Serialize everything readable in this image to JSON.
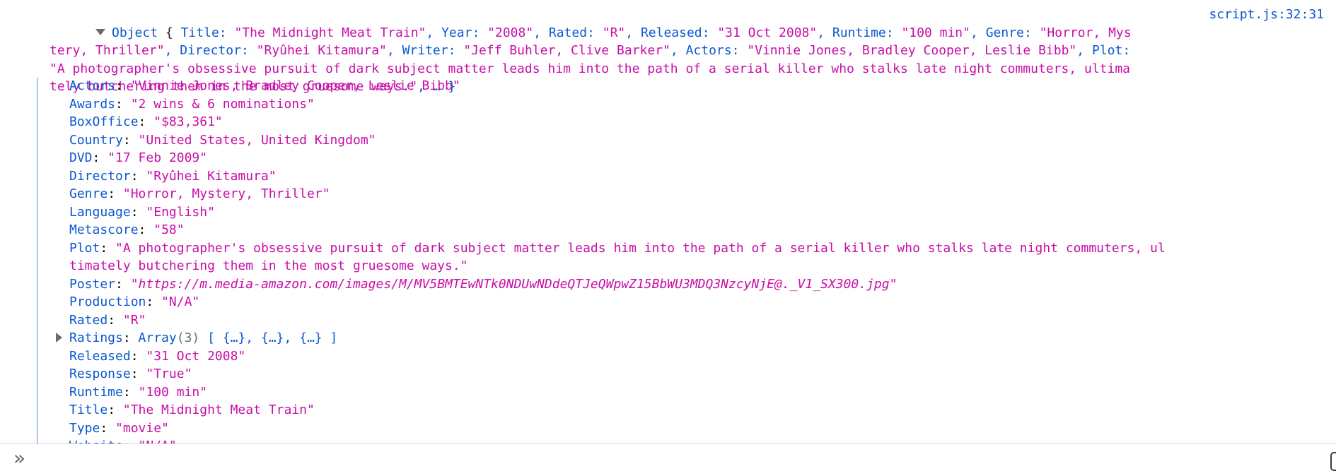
{
  "source": "script.js:32:31",
  "summary": {
    "type_label": "Object",
    "open_brace": "{",
    "close": "… }",
    "entries": [
      {
        "key": "Title",
        "value": "\"The Midnight Meat Train\""
      },
      {
        "key": "Year",
        "value": "\"2008\""
      },
      {
        "key": "Rated",
        "value": "\"R\""
      },
      {
        "key": "Released",
        "value": "\"31 Oct 2008\""
      },
      {
        "key": "Runtime",
        "value": "\"100 min\""
      },
      {
        "key": "Genre",
        "value": "\"Horror, Mystery, Thriller\""
      },
      {
        "key": "Director",
        "value": "\"Ryûhei Kitamura\""
      },
      {
        "key": "Writer",
        "value": "\"Jeff Buhler, Clive Barker\""
      },
      {
        "key": "Actors",
        "value": "\"Vinnie Jones, Bradley Cooper, Leslie Bibb\""
      },
      {
        "key": "Plot",
        "value": "\"A photographer's obsessive pursuit of dark subject matter leads him into the path of a serial killer who stalks late night commuters, ultimately butchering them in the most gruesome ways.\""
      }
    ]
  },
  "properties": [
    {
      "key": "Actors",
      "value": "\"Vinnie Jones, Bradley Cooper, Leslie Bibb\""
    },
    {
      "key": "Awards",
      "value": "\"2 wins & 6 nominations\""
    },
    {
      "key": "BoxOffice",
      "value": "\"$83,361\""
    },
    {
      "key": "Country",
      "value": "\"United States, United Kingdom\""
    },
    {
      "key": "DVD",
      "value": "\"17 Feb 2009\""
    },
    {
      "key": "Director",
      "value": "\"Ryûhei Kitamura\""
    },
    {
      "key": "Genre",
      "value": "\"Horror, Mystery, Thriller\""
    },
    {
      "key": "Language",
      "value": "\"English\""
    },
    {
      "key": "Metascore",
      "value": "\"58\""
    },
    {
      "key": "Plot",
      "value": "\"A photographer's obsessive pursuit of dark subject matter leads him into the path of a serial killer who stalks late night commuters, ultimately butchering them in the most gruesome ways.\""
    },
    {
      "key": "Poster",
      "value": "\"https://m.media-amazon.com/images/M/MV5BMTEwNTk0NDUwNDdeQTJeQWpwZ15BbWU3MDQ3NzcyNjE@._V1_SX300.jpg\"",
      "style": "url"
    },
    {
      "key": "Production",
      "value": "\"N/A\""
    },
    {
      "key": "Rated",
      "value": "\"R\""
    },
    {
      "key": "Ratings",
      "type_label": "Array",
      "count": "(3)",
      "preview": "[ {…}, {…}, {…} ]",
      "collapsed": true
    },
    {
      "key": "Released",
      "value": "\"31 Oct 2008\""
    },
    {
      "key": "Response",
      "value": "\"True\""
    },
    {
      "key": "Runtime",
      "value": "\"100 min\""
    },
    {
      "key": "Title",
      "value": "\"The Midnight Meat Train\""
    },
    {
      "key": "Type",
      "value": "\"movie\""
    },
    {
      "key": "Website",
      "value": "\"N/A\""
    }
  ],
  "colors": {
    "string": "#c80ea8",
    "key": "#0b57d0",
    "guide": "#4f8bd9"
  },
  "icons": {
    "expand": "triangle-down-icon",
    "collapsed": "triangle-right-icon",
    "prompt": "chevron-double-right-icon"
  }
}
